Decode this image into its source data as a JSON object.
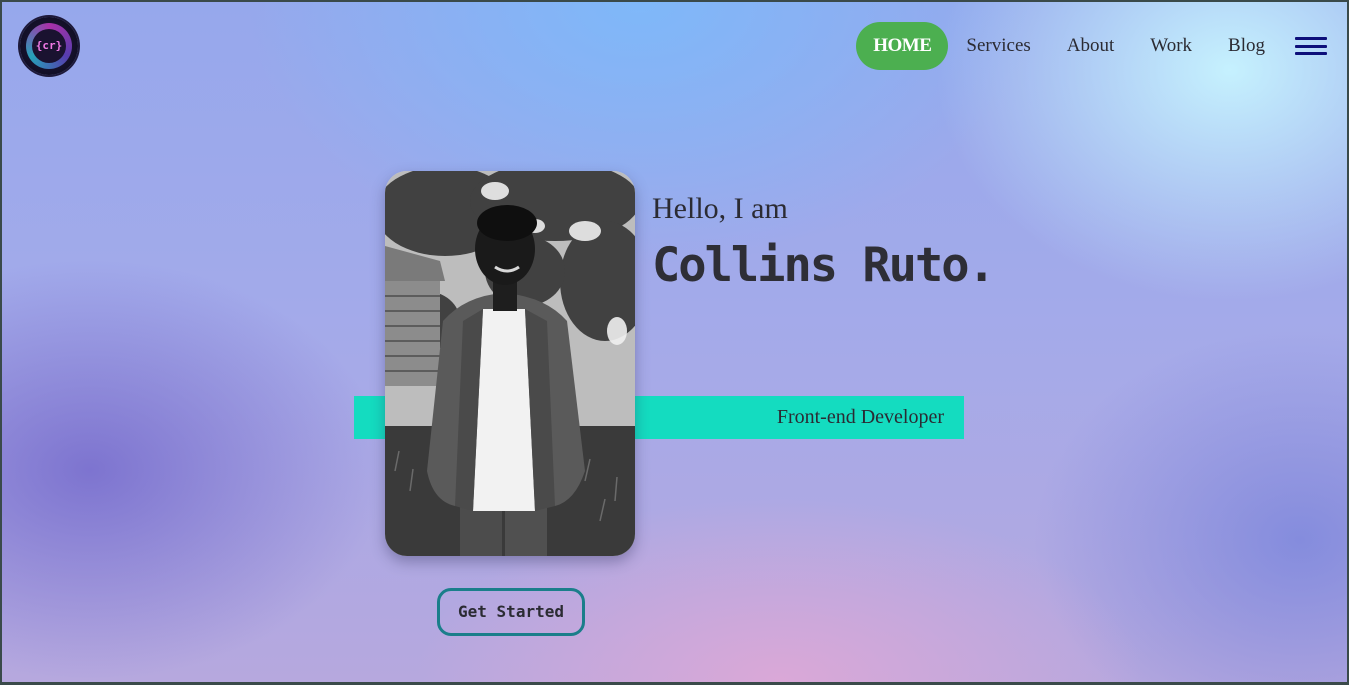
{
  "logo": {
    "text": "{cr}",
    "icon": "logo-icon"
  },
  "nav": {
    "items": [
      {
        "label": "HOME",
        "active": true
      },
      {
        "label": "Services",
        "active": false
      },
      {
        "label": "About",
        "active": false
      },
      {
        "label": "Work",
        "active": false
      },
      {
        "label": "Blog",
        "active": false
      }
    ],
    "menu_icon": "hamburger-menu-icon",
    "active_color": "#4caf50"
  },
  "hero": {
    "greeting": "Hello, I am",
    "name": "Collins Ruto.",
    "role": "Front-end Developer",
    "cta_label": "Get Started",
    "accent_color": "#14dcc0",
    "cta_border_color": "#1a7e8a"
  }
}
